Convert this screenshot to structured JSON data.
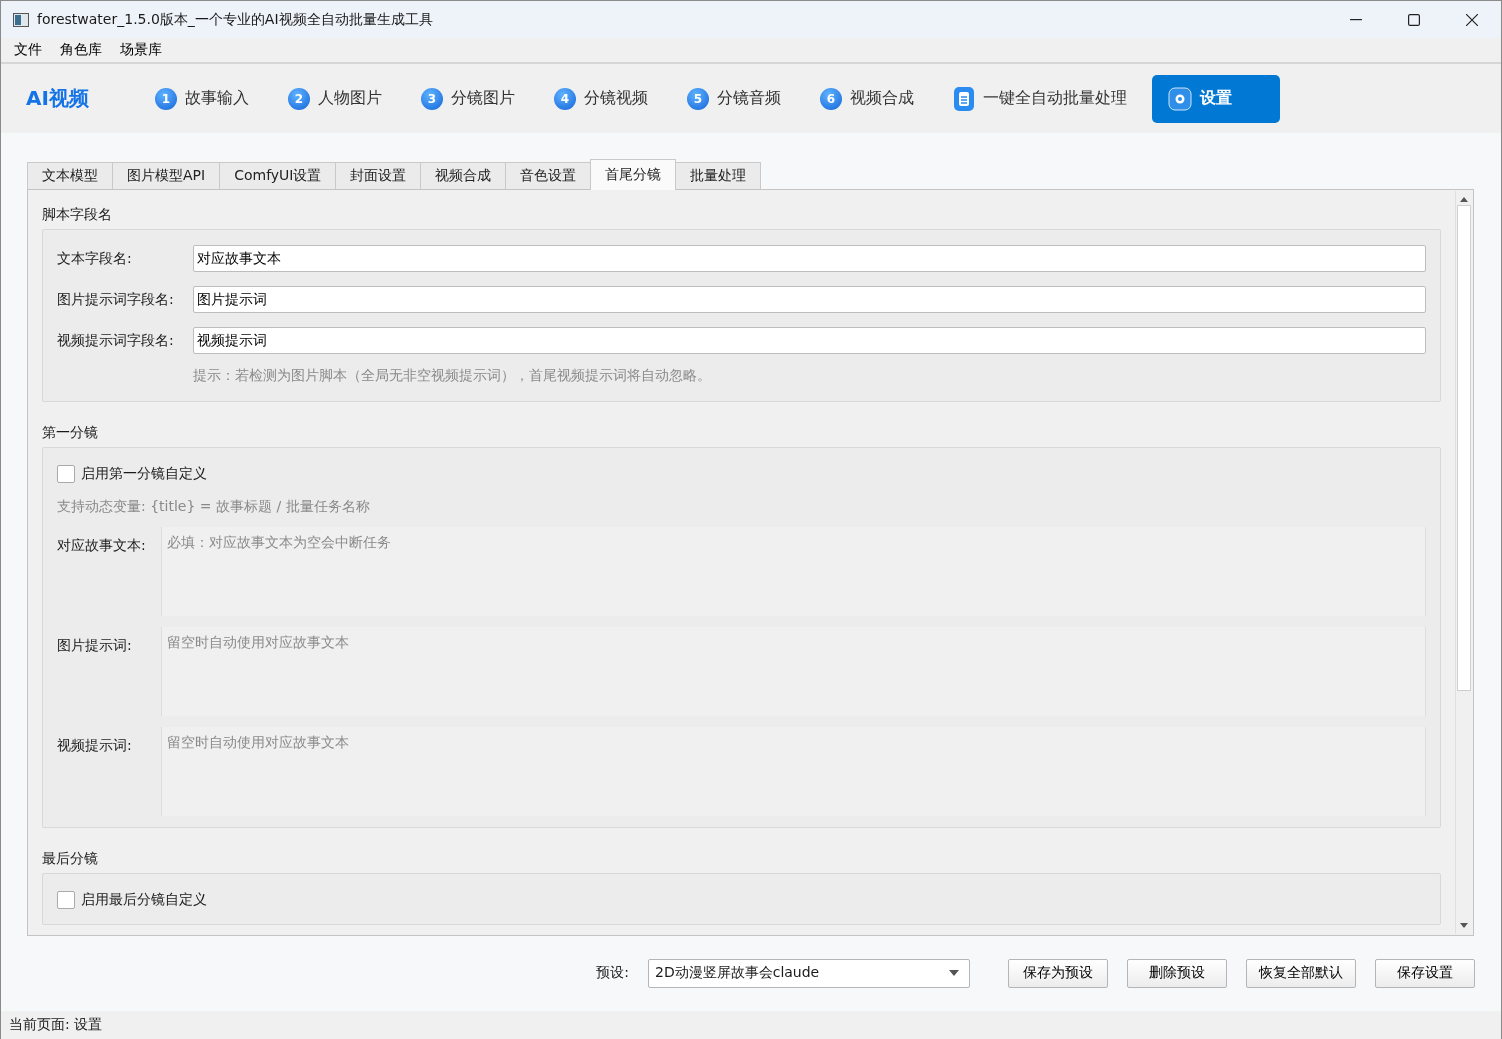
{
  "window": {
    "title": "forestwater_1.5.0版本_一个专业的AI视频全自动批量生成工具"
  },
  "menu": [
    "文件",
    "角色库",
    "场景库"
  ],
  "nav": {
    "brand": "AI视频",
    "items": [
      {
        "kind": "step",
        "number": "1",
        "label": "故事输入",
        "selected": false
      },
      {
        "kind": "step",
        "number": "2",
        "label": "人物图片",
        "selected": false
      },
      {
        "kind": "step",
        "number": "3",
        "label": "分镜图片",
        "selected": false
      },
      {
        "kind": "step",
        "number": "4",
        "label": "分镜视频",
        "selected": false
      },
      {
        "kind": "step",
        "number": "5",
        "label": "分镜音频",
        "selected": false
      },
      {
        "kind": "step",
        "number": "6",
        "label": "视频合成",
        "selected": false
      },
      {
        "kind": "doc",
        "label": "一键全自动批量处理",
        "selected": false
      },
      {
        "kind": "gear",
        "label": "设置",
        "selected": true
      }
    ]
  },
  "tabs": [
    {
      "label": "文本模型",
      "selected": false
    },
    {
      "label": "图片模型API",
      "selected": false
    },
    {
      "label": "ComfyUI设置",
      "selected": false
    },
    {
      "label": "封面设置",
      "selected": false
    },
    {
      "label": "视频合成",
      "selected": false
    },
    {
      "label": "音色设置",
      "selected": false
    },
    {
      "label": "首尾分镜",
      "selected": true
    },
    {
      "label": "批量处理",
      "selected": false
    }
  ],
  "sections": [
    {
      "kind": "fields",
      "title": "脚本字段名",
      "fields": [
        {
          "label": "文本字段名:",
          "value": "对应故事文本"
        },
        {
          "label": "图片提示词字段名:",
          "value": "图片提示词"
        },
        {
          "label": "视频提示词字段名:",
          "value": "视频提示词"
        }
      ],
      "hint": "提示：若检测为图片脚本（全局无非空视频提示词），首尾视频提示词将自动忽略。"
    },
    {
      "kind": "custom",
      "title": "第一分镜",
      "checkbox": {
        "label": "启用第一分镜自定义",
        "checked": false
      },
      "hint": "支持动态变量: {title} = 故事标题 / 批量任务名称",
      "areas": [
        {
          "label": "对应故事文本:",
          "placeholder": "必填：对应故事文本为空会中断任务"
        },
        {
          "label": "图片提示词:",
          "placeholder": "留空时自动使用对应故事文本"
        },
        {
          "label": "视频提示词:",
          "placeholder": "留空时自动使用对应故事文本"
        }
      ]
    },
    {
      "kind": "custom",
      "title": "最后分镜",
      "checkbox": {
        "label": "启用最后分镜自定义",
        "checked": false
      }
    }
  ],
  "footer": {
    "preset_label": "预设:",
    "preset": "2D动漫竖屏故事会claude",
    "buttons": [
      "保存为预设",
      "删除预设",
      "恢复全部默认",
      "保存设置"
    ]
  },
  "status_bar": "当前页面: 设置"
}
